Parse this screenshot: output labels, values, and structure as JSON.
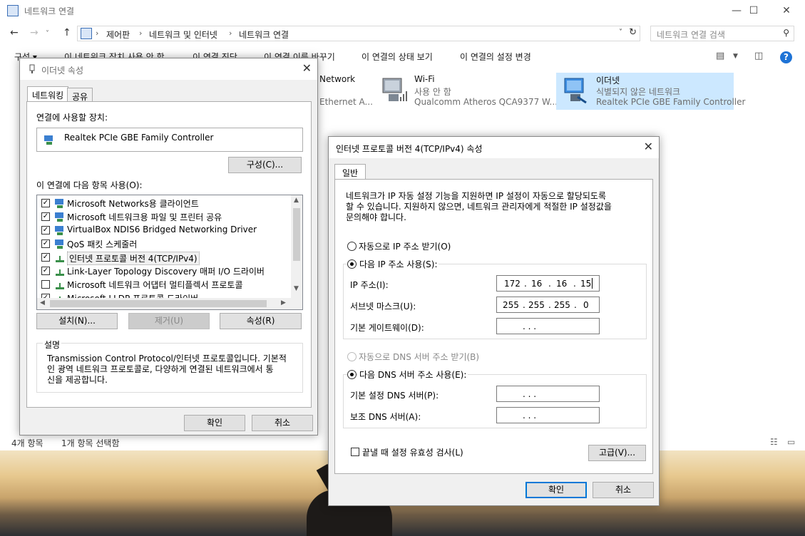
{
  "explorer": {
    "title": "네트워크 연결",
    "window_controls": {
      "minimize": "—",
      "maximize": "☐",
      "close": "✕"
    },
    "nav": {
      "back": "←",
      "forward": "→",
      "up": "↑"
    },
    "breadcrumb": [
      "제어판",
      "네트워크 및 인터넷",
      "네트워크 연결"
    ],
    "search_placeholder": "네트워크 연결 검색",
    "commands": [
      "구성 ▾",
      "이 네트워크 장치 사용 안 함",
      "이 연결 진단",
      "이 연결 이름 바꾸기",
      "이 연결의 상태 보기",
      "이 연결의 설정 변경"
    ],
    "help": "?",
    "adapters": [
      {
        "name": "Network",
        "status": "",
        "device": "Ethernet A..."
      },
      {
        "name": "Wi-Fi",
        "status": "사용 안 함",
        "device": "Qualcomm Atheros QCA9377 W..."
      },
      {
        "name": "이더넷",
        "status": "식별되지 않은 네트워크",
        "device": "Realtek PCIe GBE Family Controller"
      }
    ],
    "status": {
      "count": "4개 항목",
      "selected": "1개 항목 선택함"
    }
  },
  "eth_dialog": {
    "title": "이더넷 속성",
    "tabs": [
      "네트워킹",
      "공유"
    ],
    "connect_using_label": "연결에 사용할 장치:",
    "device": "Realtek PCIe GBE Family Controller",
    "configure": "구성(C)...",
    "items_label": "이 연결에 다음 항목 사용(O):",
    "items": [
      {
        "text": "Microsoft Networks용 클라이언트",
        "checked": true
      },
      {
        "text": "Microsoft 네트워크용 파일 및 프린터 공유",
        "checked": true
      },
      {
        "text": "VirtualBox NDIS6 Bridged Networking Driver",
        "checked": true
      },
      {
        "text": "QoS 패킷 스케줄러",
        "checked": true
      },
      {
        "text": "인터넷 프로토콜 버전 4(TCP/IPv4)",
        "checked": true
      },
      {
        "text": "Link-Layer Topology Discovery 매퍼 I/O 드라이버",
        "checked": true
      },
      {
        "text": "Microsoft 네트워크 어댑터 멀티플렉서 프로토콜",
        "checked": false
      },
      {
        "text": "Microsoft LLDP 프로토콜 드라이버",
        "checked": true
      }
    ],
    "install": "설치(N)...",
    "remove": "제거(U)",
    "properties": "속성(R)",
    "desc_title": "설명",
    "desc_text_1": "Transmission Control Protocol/인터넷 프로토콜입니다. 기본적",
    "desc_text_2": "인 광역 네트워크 프로토콜로, 다양하게 연결된 네트워크에서 통",
    "desc_text_3": "신을 제공합니다.",
    "ok": "확인",
    "cancel": "취소"
  },
  "ipv4_dialog": {
    "title": "인터넷 프로토콜 버전 4(TCP/IPv4) 속성",
    "tab": "일반",
    "intro_1": "네트워크가 IP 자동 설정 기능을 지원하면 IP 설정이 자동으로 할당되도록",
    "intro_2": "할 수 있습니다. 지원하지 않으면, 네트워크 관리자에게 적절한 IP 설정값을",
    "intro_3": "문의해야 합니다.",
    "auto_ip": "자동으로 IP 주소 받기(O)",
    "manual_ip": "다음 IP 주소 사용(S):",
    "ip_label": "IP 주소(I):",
    "ip_value": [
      "172",
      "16",
      "16",
      "15"
    ],
    "subnet_label": "서브넷 마스크(U):",
    "subnet_value": [
      "255",
      "255",
      "255",
      "0"
    ],
    "gateway_label": "기본 게이트웨이(D):",
    "auto_dns": "자동으로 DNS 서버 주소 받기(B)",
    "manual_dns": "다음 DNS 서버 주소 사용(E):",
    "dns1_label": "기본 설정 DNS 서버(P):",
    "dns2_label": "보조 DNS 서버(A):",
    "validate": "끝낼 때 설정 유효성 검사(L)",
    "advanced": "고급(V)...",
    "ok": "확인",
    "cancel": "취소",
    "dots": ".      .      ."
  }
}
